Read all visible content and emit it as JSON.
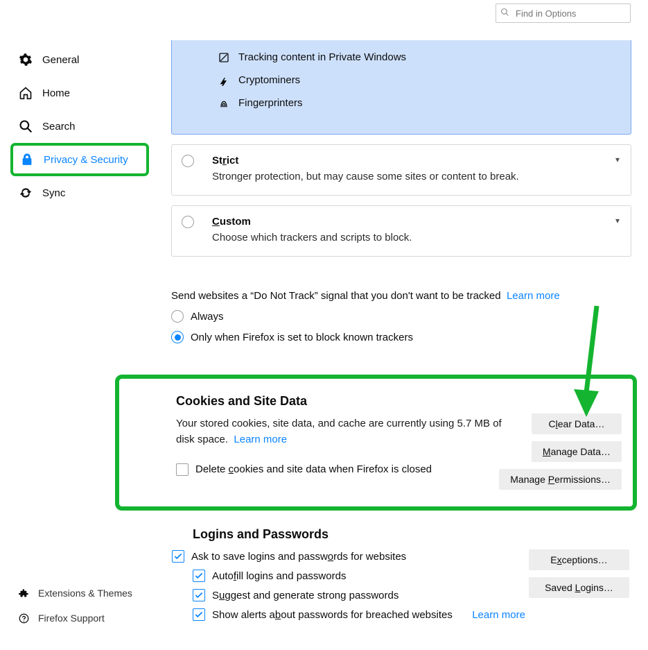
{
  "search": {
    "placeholder": "Find in Options"
  },
  "sidebar": {
    "items": [
      {
        "label": "General"
      },
      {
        "label": "Home"
      },
      {
        "label": "Search"
      },
      {
        "label": "Privacy & Security"
      },
      {
        "label": "Sync"
      }
    ]
  },
  "footer": {
    "extensions": "Extensions & Themes",
    "support": "Firefox Support"
  },
  "protection_items": {
    "tracking": "Tracking content in Private Windows",
    "cryptominers": "Cryptominers",
    "fingerprinters": "Fingerprinters"
  },
  "cards": {
    "strict": {
      "title_pre": "St",
      "title_u": "r",
      "title_post": "ict",
      "desc": "Stronger protection, but may cause some sites or content to break."
    },
    "custom": {
      "title_pre": "",
      "title_u": "C",
      "title_post": "ustom",
      "desc": "Choose which trackers and scripts to block."
    }
  },
  "dnt": {
    "text": "Send websites a “Do Not Track” signal that you don't want to be tracked",
    "learn_more": "Learn more",
    "always": "Always",
    "only_known": "Only when Firefox is set to block known trackers"
  },
  "cookies": {
    "title": "Cookies and Site Data",
    "desc_pre": "Your stored cookies, site data, and cache are currently using ",
    "size": "5.7 MB",
    "desc_post": " of disk space.",
    "learn_more": "Learn more",
    "delete_label_pre": "Delete ",
    "delete_label_u": "c",
    "delete_label_post": "ookies and site data when Firefox is closed",
    "buttons": {
      "clear_pre": "C",
      "clear_u": "l",
      "clear_post": "ear Data…",
      "manage_pre": "",
      "manage_u": "M",
      "manage_post": "anage Data…",
      "perm_pre": "Manage ",
      "perm_u": "P",
      "perm_post": "ermissions…"
    }
  },
  "logins": {
    "title": "Logins and Passwords",
    "ask_save_pre": "Ask to save logins and passw",
    "ask_save_u": "o",
    "ask_save_post": "rds for websites",
    "autofill_pre": "Auto",
    "autofill_u": "f",
    "autofill_post": "ill logins and passwords",
    "suggest_pre": "S",
    "suggest_u": "u",
    "suggest_post": "ggest and generate strong passwords",
    "alerts_pre": "Show alerts a",
    "alerts_u": "b",
    "alerts_post": "out passwords for breached websites",
    "learn_more": "Learn more",
    "buttons": {
      "exceptions_pre": "E",
      "exceptions_u": "x",
      "exceptions_post": "ceptions…",
      "saved_pre": "Saved ",
      "saved_u": "L",
      "saved_post": "ogins…"
    }
  }
}
